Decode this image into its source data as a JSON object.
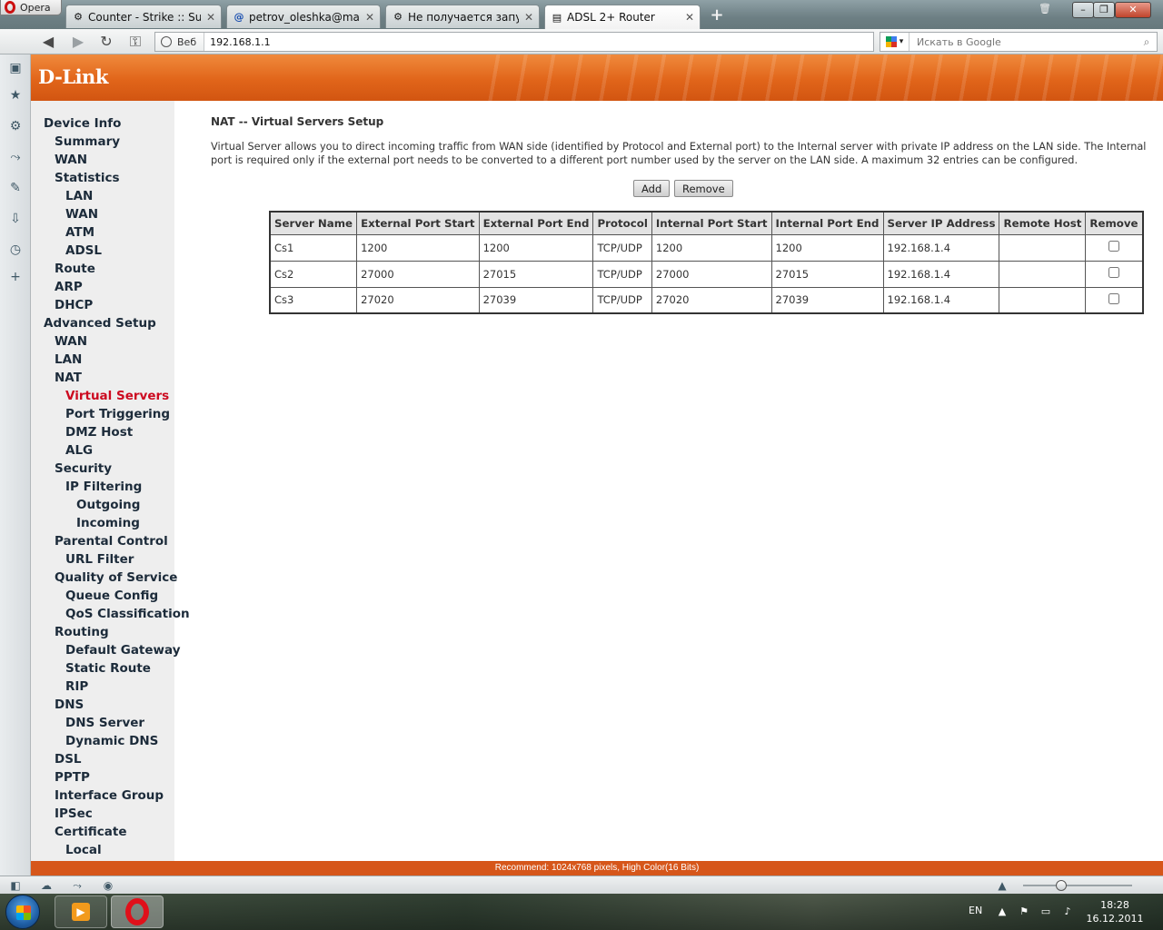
{
  "browser": {
    "menu_label": "Opera",
    "tabs": [
      {
        "title": "Counter - Strike :: Supp..."
      },
      {
        "title": "petrov_oleshka@mail.r..."
      },
      {
        "title": "Не получается запуст..."
      },
      {
        "title": "ADSL 2+ Router"
      }
    ],
    "address_badge": "Веб",
    "url": "192.168.1.1",
    "search_placeholder": "Искать в Google"
  },
  "router": {
    "brand": "D-Link",
    "nav": [
      {
        "label": "Device Info",
        "level": 0
      },
      {
        "label": "Summary",
        "level": 1
      },
      {
        "label": "WAN",
        "level": 1
      },
      {
        "label": "Statistics",
        "level": 1
      },
      {
        "label": "LAN",
        "level": 2
      },
      {
        "label": "WAN",
        "level": 2
      },
      {
        "label": "ATM",
        "level": 2
      },
      {
        "label": "ADSL",
        "level": 2
      },
      {
        "label": "Route",
        "level": 1
      },
      {
        "label": "ARP",
        "level": 1
      },
      {
        "label": "DHCP",
        "level": 1
      },
      {
        "label": "Advanced Setup",
        "level": 0
      },
      {
        "label": "WAN",
        "level": 1
      },
      {
        "label": "LAN",
        "level": 1
      },
      {
        "label": "NAT",
        "level": 1
      },
      {
        "label": "Virtual Servers",
        "level": 2,
        "current": true
      },
      {
        "label": "Port Triggering",
        "level": 2
      },
      {
        "label": "DMZ Host",
        "level": 2
      },
      {
        "label": "ALG",
        "level": 2
      },
      {
        "label": "Security",
        "level": 1
      },
      {
        "label": "IP Filtering",
        "level": 2
      },
      {
        "label": "Outgoing",
        "level": 3
      },
      {
        "label": "Incoming",
        "level": 3
      },
      {
        "label": "Parental Control",
        "level": 1
      },
      {
        "label": "URL Filter",
        "level": 2
      },
      {
        "label": "Quality of Service",
        "level": 1
      },
      {
        "label": "Queue Config",
        "level": 2
      },
      {
        "label": "QoS Classification",
        "level": 2
      },
      {
        "label": "Routing",
        "level": 1
      },
      {
        "label": "Default Gateway",
        "level": 2
      },
      {
        "label": "Static Route",
        "level": 2
      },
      {
        "label": "RIP",
        "level": 2
      },
      {
        "label": "DNS",
        "level": 1
      },
      {
        "label": "DNS Server",
        "level": 2
      },
      {
        "label": "Dynamic DNS",
        "level": 2
      },
      {
        "label": "DSL",
        "level": 1
      },
      {
        "label": "PPTP",
        "level": 1
      },
      {
        "label": "Interface Group",
        "level": 1
      },
      {
        "label": "IPSec",
        "level": 1
      },
      {
        "label": "Certificate",
        "level": 1
      },
      {
        "label": "Local",
        "level": 2
      }
    ],
    "page_title": "NAT -- Virtual Servers Setup",
    "description": "Virtual Server allows you to direct incoming traffic from WAN side (identified by Protocol and External port) to the Internal server with private IP address on the LAN side. The Internal port is required only if the external port needs to be converted to a different port number used by the server on the LAN side. A maximum 32 entries can be configured.",
    "add_label": "Add",
    "remove_label": "Remove",
    "table": {
      "columns": [
        "Server Name",
        "External Port Start",
        "External Port End",
        "Protocol",
        "Internal Port Start",
        "Internal Port End",
        "Server IP Address",
        "Remote Host",
        "Remove"
      ],
      "rows": [
        [
          "Cs1",
          "1200",
          "1200",
          "TCP/UDP",
          "1200",
          "1200",
          "192.168.1.4",
          ""
        ],
        [
          "Cs2",
          "27000",
          "27015",
          "TCP/UDP",
          "27000",
          "27015",
          "192.168.1.4",
          ""
        ],
        [
          "Cs3",
          "27020",
          "27039",
          "TCP/UDP",
          "27020",
          "27039",
          "192.168.1.4",
          ""
        ]
      ]
    },
    "footer": "Recommend: 1024x768 pixels, High Color(16 Bits)"
  },
  "taskbar": {
    "lang": "EN",
    "time": "18:28",
    "date": "16.12.2011"
  },
  "colors": {
    "brand_orange": "#e1651a",
    "nav_current": "#cc0a20",
    "footer_orange": "#d6561a"
  }
}
